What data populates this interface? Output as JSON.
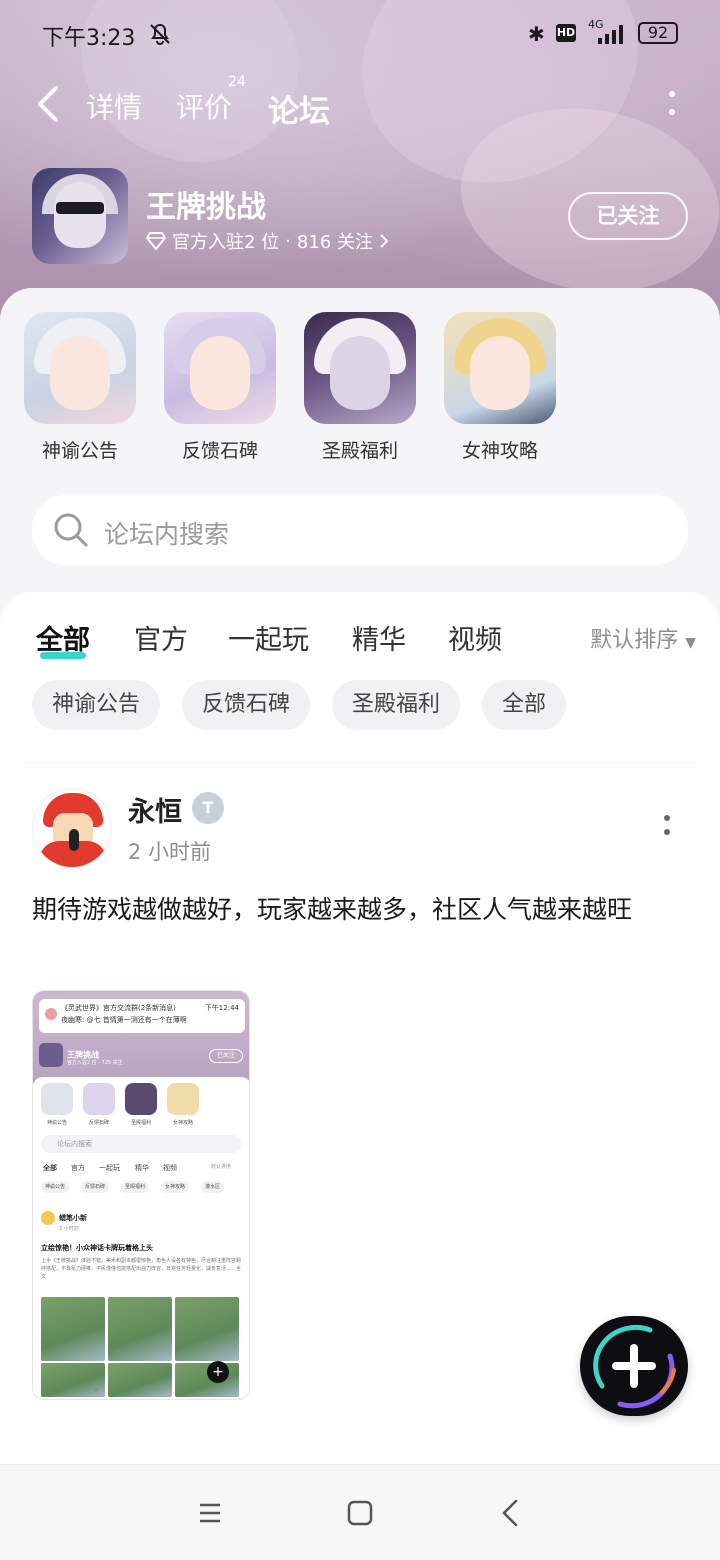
{
  "status_bar": {
    "time": "下午3:23",
    "network": "4G",
    "battery": "92",
    "hd_label": "HD"
  },
  "nav": {
    "tabs": [
      {
        "label": "详情"
      },
      {
        "label": "评价",
        "badge": "24"
      },
      {
        "label": "论坛",
        "active": true
      }
    ],
    "accent_color": "#3fd2c6"
  },
  "game": {
    "name": "王牌挑战",
    "official_count": "官方入驻2 位",
    "followers": "816 关注",
    "separator": "·",
    "follow_button": "已关注"
  },
  "sections": [
    {
      "label": "神谕公告"
    },
    {
      "label": "反馈石碑"
    },
    {
      "label": "圣殿福利"
    },
    {
      "label": "女神攻略"
    }
  ],
  "search": {
    "placeholder": "论坛内搜索"
  },
  "feed_tabs": [
    {
      "label": "全部",
      "active": true
    },
    {
      "label": "官方"
    },
    {
      "label": "一起玩"
    },
    {
      "label": "精华"
    },
    {
      "label": "视频"
    }
  ],
  "sort": {
    "label": "默认排序"
  },
  "chips": [
    {
      "label": "神谕公告"
    },
    {
      "label": "反馈石碑"
    },
    {
      "label": "圣殿福利"
    },
    {
      "label": "全部"
    }
  ],
  "post": {
    "username": "永恒",
    "user_badge": "T",
    "time": "2 小时前",
    "text": "期待游戏越做越好，玩家越来越多，社区人气越来越旺",
    "image": {
      "notice_title": "《灵武世界》官方交流群(2条新消息)",
      "notice_time": "下午12:44",
      "notice_body": "夜幽寒: @七 首情第一测还有一个在薄啊",
      "game_name": "王牌挑战",
      "game_meta": "官方入驻2 位 · 725 关注",
      "follow": "已关注",
      "sections": [
        "神谕公告",
        "反馈石碑",
        "圣殿福利",
        "女神攻略"
      ],
      "search": "论坛内搜索",
      "tabs": [
        "全部",
        "官方",
        "一起玩",
        "精华",
        "视频"
      ],
      "sort": "默认排序",
      "chips": [
        "神谕公告",
        "反馈石碑",
        "圣殿福利",
        "女神攻略",
        "灌水区"
      ],
      "user": "蜡笔小新",
      "user_time": "3 小时前",
      "post_title": "立绘惊艳！小众神话卡牌玩着格上头",
      "post_body": "上手《王牌挑战》体验不错，美术和副本都很惊艳，角色人设各有特色，尽合制注重阵容羁绊搭配，不靠氪力硬推，平民僅僅也能搭配出强力阵容，日常任务轻量化，减负复活……全文",
      "nav": [
        "≡",
        "□",
        "‹"
      ],
      "fab": "+"
    }
  },
  "system_nav": [
    "menu",
    "home",
    "back"
  ]
}
